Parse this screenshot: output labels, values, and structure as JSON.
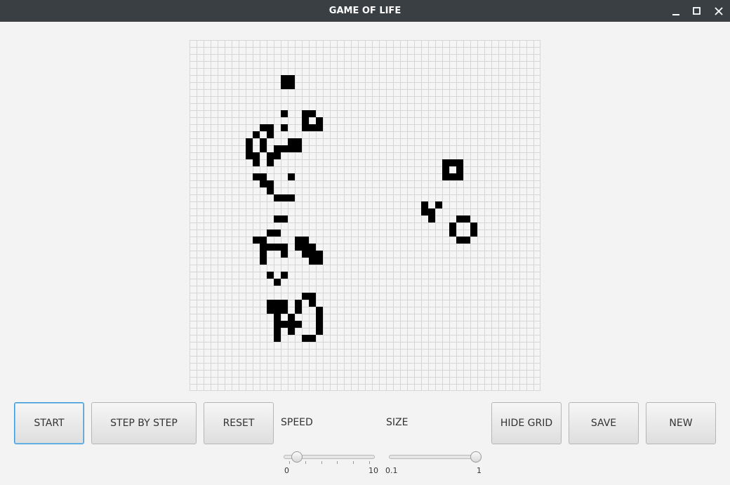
{
  "window": {
    "title": "GAME OF LIFE"
  },
  "grid": {
    "columns": 50,
    "rows": 50,
    "show_grid": true,
    "alive_color": "#000000",
    "line_color": "#d6d6d6",
    "background": "#f5f5f5",
    "alive_cells": [
      [
        13,
        5
      ],
      [
        14,
        5
      ],
      [
        13,
        6
      ],
      [
        14,
        6
      ],
      [
        13,
        10
      ],
      [
        16,
        10
      ],
      [
        17,
        10
      ],
      [
        16,
        11
      ],
      [
        18,
        11
      ],
      [
        10,
        12
      ],
      [
        11,
        12
      ],
      [
        11,
        13
      ],
      [
        13,
        12
      ],
      [
        16,
        12
      ],
      [
        17,
        12
      ],
      [
        18,
        12
      ],
      [
        9,
        13
      ],
      [
        11,
        13
      ],
      [
        8,
        14
      ],
      [
        10,
        14
      ],
      [
        14,
        14
      ],
      [
        15,
        14
      ],
      [
        8,
        15
      ],
      [
        10,
        15
      ],
      [
        12,
        15
      ],
      [
        13,
        15
      ],
      [
        14,
        15
      ],
      [
        15,
        15
      ],
      [
        8,
        16
      ],
      [
        9,
        16
      ],
      [
        11,
        16
      ],
      [
        12,
        16
      ],
      [
        9,
        17
      ],
      [
        11,
        17
      ],
      [
        9,
        19
      ],
      [
        10,
        19
      ],
      [
        14,
        19
      ],
      [
        10,
        20
      ],
      [
        11,
        20
      ],
      [
        11,
        21
      ],
      [
        12,
        22
      ],
      [
        13,
        22
      ],
      [
        14,
        22
      ],
      [
        12,
        25
      ],
      [
        13,
        25
      ],
      [
        11,
        27
      ],
      [
        12,
        27
      ],
      [
        9,
        28
      ],
      [
        10,
        28
      ],
      [
        15,
        28
      ],
      [
        16,
        28
      ],
      [
        10,
        29
      ],
      [
        11,
        29
      ],
      [
        12,
        29
      ],
      [
        13,
        29
      ],
      [
        15,
        29
      ],
      [
        16,
        29
      ],
      [
        17,
        29
      ],
      [
        10,
        30
      ],
      [
        13,
        30
      ],
      [
        16,
        30
      ],
      [
        17,
        30
      ],
      [
        18,
        30
      ],
      [
        10,
        31
      ],
      [
        17,
        31
      ],
      [
        18,
        31
      ],
      [
        11,
        33
      ],
      [
        13,
        33
      ],
      [
        12,
        34
      ],
      [
        16,
        36
      ],
      [
        17,
        36
      ],
      [
        11,
        37
      ],
      [
        12,
        37
      ],
      [
        13,
        37
      ],
      [
        15,
        37
      ],
      [
        17,
        37
      ],
      [
        11,
        38
      ],
      [
        12,
        38
      ],
      [
        13,
        38
      ],
      [
        15,
        38
      ],
      [
        18,
        38
      ],
      [
        12,
        39
      ],
      [
        14,
        39
      ],
      [
        18,
        39
      ],
      [
        12,
        40
      ],
      [
        13,
        40
      ],
      [
        14,
        40
      ],
      [
        15,
        40
      ],
      [
        18,
        40
      ],
      [
        12,
        41
      ],
      [
        14,
        41
      ],
      [
        18,
        41
      ],
      [
        12,
        42
      ],
      [
        16,
        42
      ],
      [
        17,
        42
      ],
      [
        36,
        17
      ],
      [
        37,
        17
      ],
      [
        38,
        17
      ],
      [
        36,
        18
      ],
      [
        38,
        18
      ],
      [
        36,
        19
      ],
      [
        37,
        19
      ],
      [
        38,
        19
      ],
      [
        33,
        23
      ],
      [
        35,
        23
      ],
      [
        33,
        24
      ],
      [
        34,
        24
      ],
      [
        34,
        25
      ],
      [
        38,
        25
      ],
      [
        39,
        25
      ],
      [
        37,
        26
      ],
      [
        40,
        26
      ],
      [
        37,
        27
      ],
      [
        40,
        27
      ],
      [
        38,
        28
      ],
      [
        39,
        28
      ]
    ]
  },
  "controls": {
    "start_label": "START",
    "step_label": "STEP BY STEP",
    "reset_label": "RESET",
    "speed_label": "SPEED",
    "size_label": "SIZE",
    "hide_grid_label": "HIDE GRID",
    "save_label": "SAVE",
    "new_label": "NEW"
  },
  "speed_slider": {
    "min": 0,
    "max": 10,
    "value": 1,
    "min_label": "0",
    "max_label": "10"
  },
  "size_slider": {
    "min": 0.1,
    "max": 1,
    "value": 1,
    "min_label": "0.1",
    "max_label": "1"
  }
}
